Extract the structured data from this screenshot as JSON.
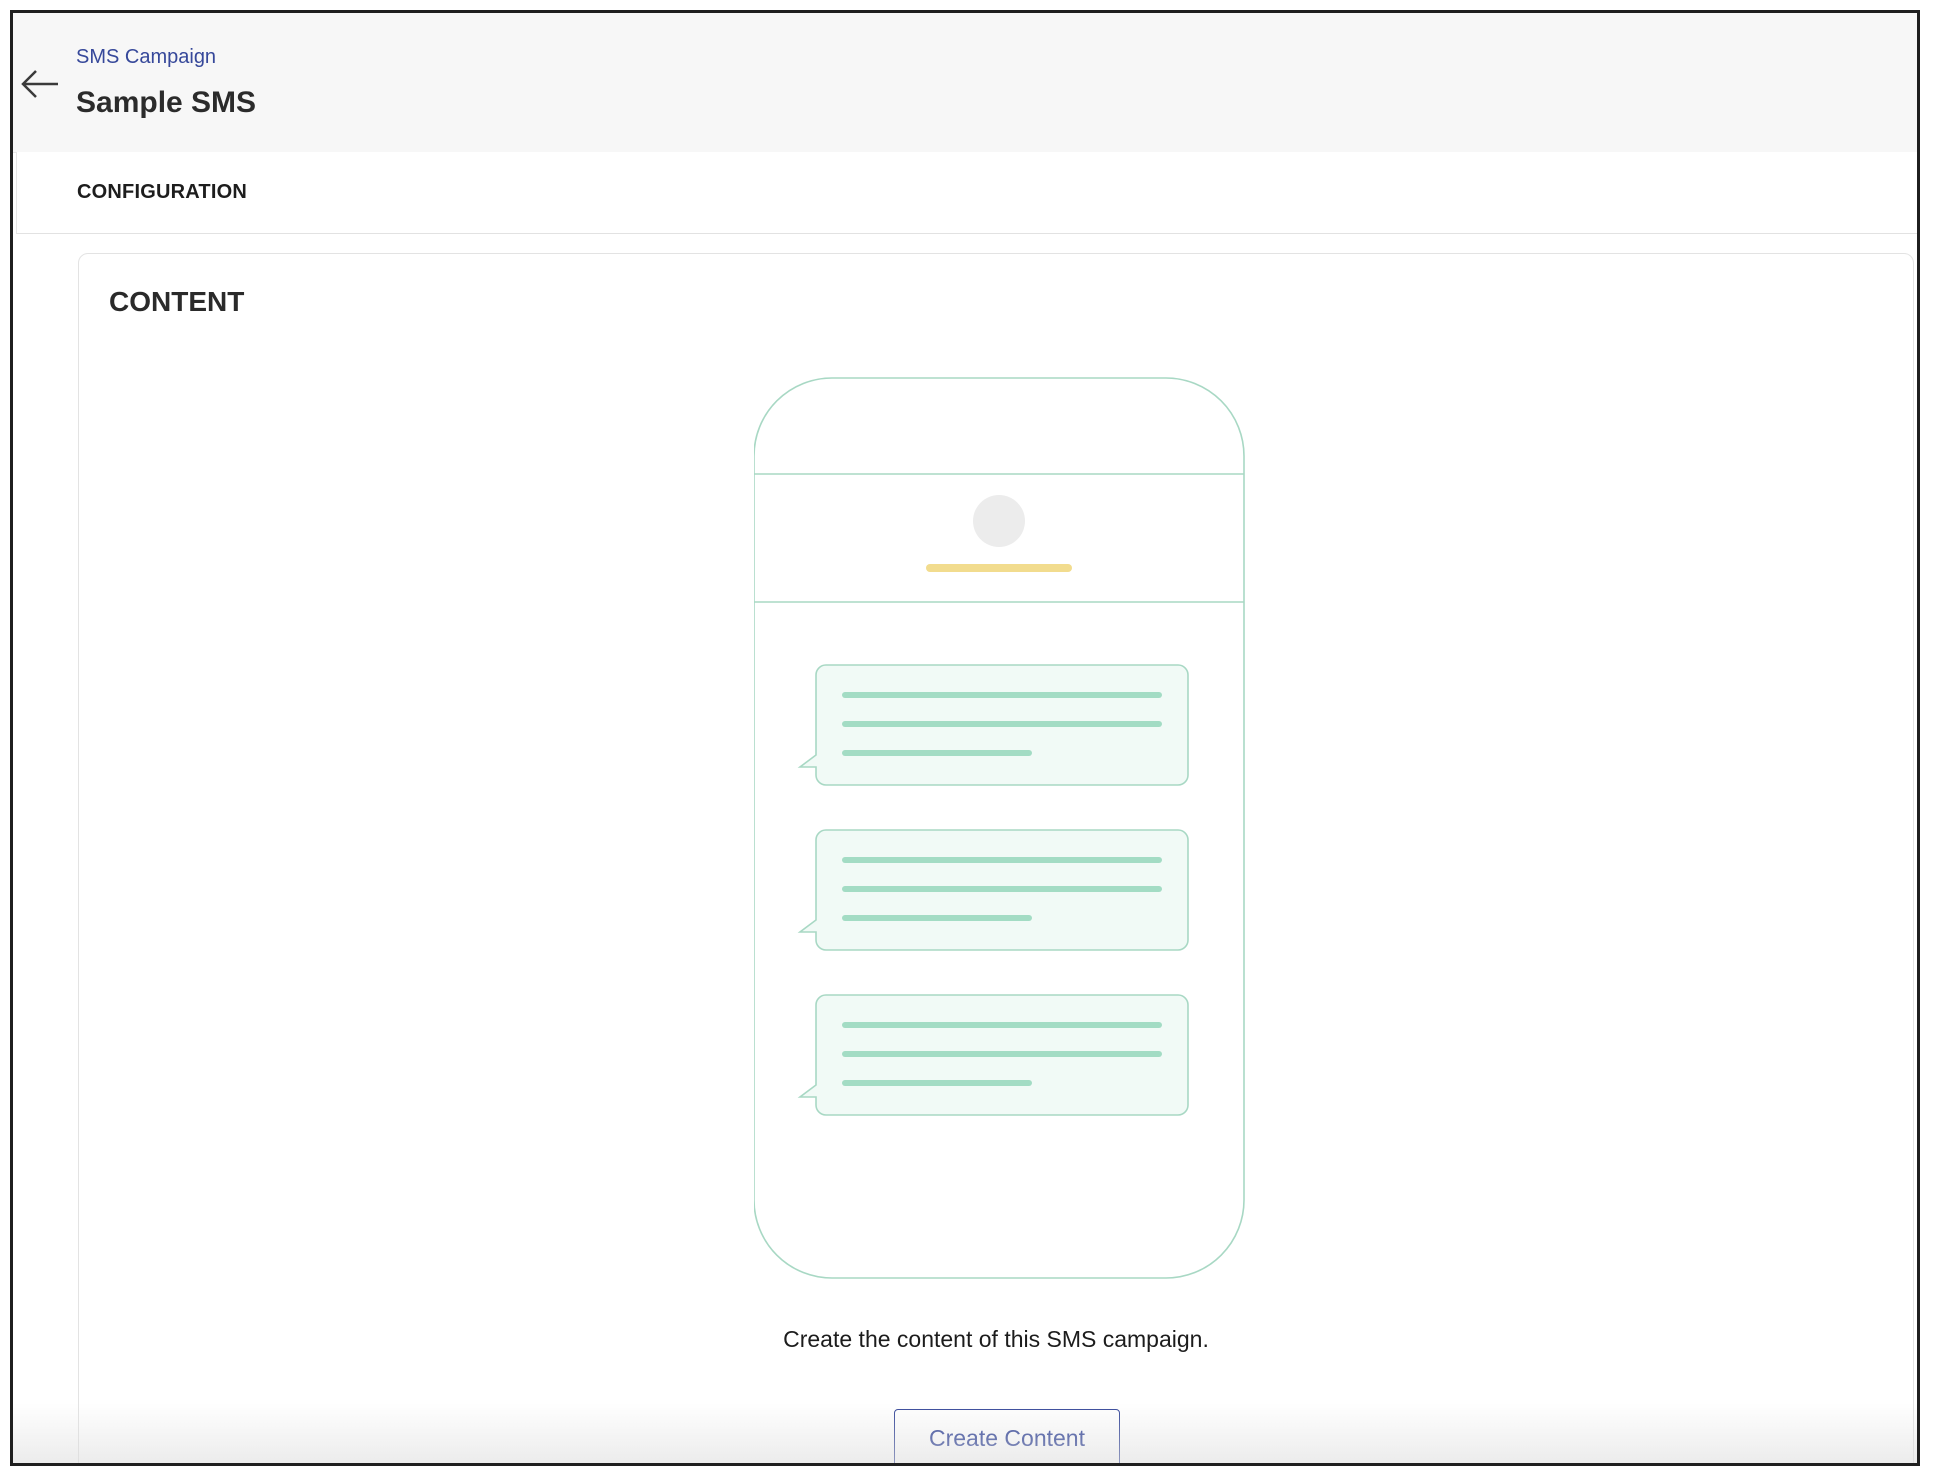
{
  "header": {
    "breadcrumb": "SMS Campaign",
    "title": "Sample SMS",
    "back_icon": "arrow-left-icon"
  },
  "tabs": {
    "configuration": "CONFIGURATION"
  },
  "content": {
    "section_title": "CONTENT",
    "description": "Create the content of this SMS campaign.",
    "create_button": "Create Content",
    "illustration_icon": "phone-sms-illustration"
  },
  "colors": {
    "accent": "#36489a",
    "illustration_stroke": "#a8d8c4",
    "bubble_fill": "#f1faf6",
    "bubble_line": "#a3dcc4",
    "name_bar": "#f2dc8e",
    "avatar": "#ececec"
  }
}
